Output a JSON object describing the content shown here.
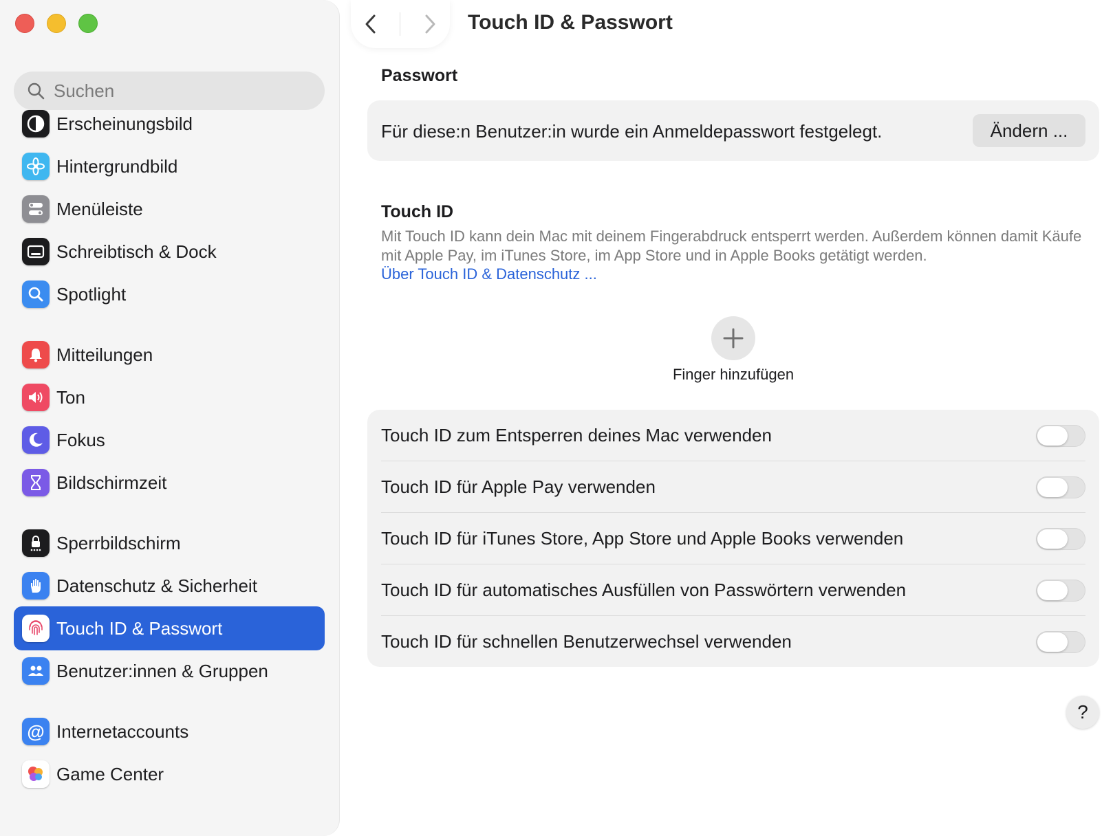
{
  "window": {
    "title": "Touch ID & Passwort"
  },
  "sidebar": {
    "search_placeholder": "Suchen",
    "items": [
      {
        "label": "Erscheinungsbild",
        "icon": "appearance-icon",
        "color": "#1c1c1e"
      },
      {
        "label": "Hintergrundbild",
        "icon": "wallpaper-flower-icon",
        "color": "#3fb7f0"
      },
      {
        "label": "Menüleiste",
        "icon": "menu-bar-icon",
        "color": "#8e8e93"
      },
      {
        "label": "Schreibtisch & Dock",
        "icon": "desktop-dock-icon",
        "color": "#1c1c1e"
      },
      {
        "label": "Spotlight",
        "icon": "spotlight-icon",
        "color": "#3b8cf0"
      },
      {
        "label": "Mitteilungen",
        "icon": "notifications-bell-icon",
        "color": "#ee4b4b"
      },
      {
        "label": "Ton",
        "icon": "sound-icon",
        "color": "#ef4a63"
      },
      {
        "label": "Fokus",
        "icon": "focus-moon-icon",
        "color": "#5e5ce6"
      },
      {
        "label": "Bildschirmzeit",
        "icon": "screen-time-hourglass-icon",
        "color": "#7b5ae6"
      },
      {
        "label": "Sperrbildschirm",
        "icon": "lock-screen-icon",
        "color": "#1c1c1e"
      },
      {
        "label": "Datenschutz & Sicherheit",
        "icon": "privacy-hand-icon",
        "color": "#3b82f0"
      },
      {
        "label": "Touch ID & Passwort",
        "icon": "fingerprint-icon",
        "color": "#ffffff",
        "active": true
      },
      {
        "label": "Benutzer:innen & Gruppen",
        "icon": "users-groups-icon",
        "color": "#3b82f0"
      },
      {
        "label": "Internetaccounts",
        "icon": "at-sign-icon",
        "color": "#3b82f0"
      },
      {
        "label": "Game Center",
        "icon": "game-center-icon",
        "color": "#ffffff"
      }
    ]
  },
  "main": {
    "password_section": {
      "title": "Passwort",
      "status_text": "Für diese:n Benutzer:in wurde ein Anmeldepasswort festgelegt.",
      "change_button": "Ändern ..."
    },
    "touch_id_section": {
      "title": "Touch ID",
      "description": "Mit Touch ID kann dein Mac mit deinem Fingerabdruck entsperrt werden. Außerdem können damit Käufe mit Apple Pay, im iTunes Store, im App Store und in Apple Books getätigt werden.",
      "link": "Über Touch ID & Datenschutz ...",
      "add_finger_label": "Finger hinzufügen"
    },
    "options": [
      {
        "label": "Touch ID zum Entsperren deines Mac verwenden",
        "enabled": false
      },
      {
        "label": "Touch ID für Apple Pay verwenden",
        "enabled": false
      },
      {
        "label": "Touch ID für iTunes Store, App Store und Apple Books verwenden",
        "enabled": false
      },
      {
        "label": "Touch ID für automatisches Ausfüllen von Passwörtern verwenden",
        "enabled": false
      },
      {
        "label": "Touch ID für schnellen Benutzerwechsel verwenden",
        "enabled": false
      }
    ],
    "help_label": "?"
  },
  "colors": {
    "accent": "#2a63d9",
    "sidebar_bg": "#f5f5f5",
    "card_bg": "#f2f2f2"
  }
}
